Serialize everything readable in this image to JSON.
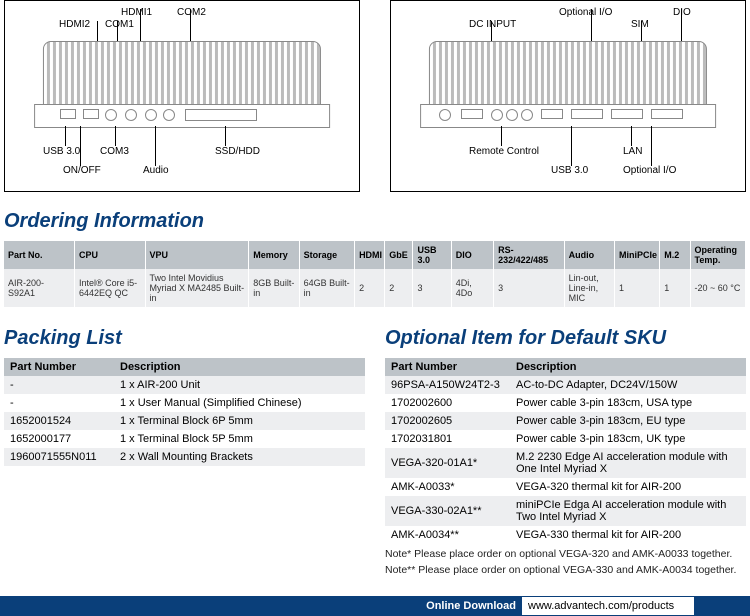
{
  "diagram_front": {
    "labels": {
      "hdmi1": "HDMI1",
      "com2": "COM2",
      "hdmi2": "HDMI2",
      "com1": "COM1",
      "usb30": "USB 3.0",
      "com3": "COM3",
      "ssd_hdd": "SSD/HDD",
      "onoff": "ON/OFF",
      "audio": "Audio"
    }
  },
  "diagram_rear": {
    "labels": {
      "optional_io_top": "Optional I/O",
      "dio": "DIO",
      "dc_input": "DC INPUT",
      "sim": "SIM",
      "remote_control": "Remote Control",
      "lan": "LAN",
      "usb30": "USB 3.0",
      "optional_io_bottom": "Optional I/O"
    }
  },
  "headings": {
    "ordering": "Ordering Information",
    "packing": "Packing List",
    "optional": "Optional Item for Default SKU"
  },
  "ordering": {
    "headers": {
      "part_no": "Part No.",
      "cpu": "CPU",
      "vpu": "VPU",
      "memory": "Memory",
      "storage": "Storage",
      "hdmi": "HDMI",
      "gbe": "GbE",
      "usb30": "USB 3.0",
      "dio": "DIO",
      "rs232": "RS-232/422/485",
      "audio": "Audio",
      "minipcie": "MiniPCIe",
      "m2": "M.2",
      "op_temp": "Operating Temp."
    },
    "row": {
      "part_no": "AIR-200-S92A1",
      "cpu": "Intel® Core i5-6442EQ QC",
      "vpu": "Two Intel Movidius Myriad X MA2485 Built-in",
      "memory": "8GB Built-in",
      "storage": "64GB Built-in",
      "hdmi": "2",
      "gbe": "2",
      "usb30": "3",
      "dio": "4Di, 4Do",
      "rs232": "3",
      "audio": "Lin-out, Line-in, MIC",
      "minipcie": "1",
      "m2": "1",
      "op_temp": "-20 ~ 60 °C"
    }
  },
  "packing": {
    "headers": {
      "pn": "Part Number",
      "desc": "Description"
    },
    "rows": [
      {
        "pn": "-",
        "desc": "1 x AIR-200 Unit"
      },
      {
        "pn": "-",
        "desc": "1 x User Manual (Simplified Chinese)"
      },
      {
        "pn": "1652001524",
        "desc": "1 x Terminal Block 6P 5mm"
      },
      {
        "pn": "1652000177",
        "desc": "1 x Terminal Block 5P 5mm"
      },
      {
        "pn": "1960071555N011",
        "desc": "2 x Wall Mounting Brackets"
      }
    ]
  },
  "optional_items": {
    "headers": {
      "pn": "Part Number",
      "desc": "Description"
    },
    "rows": [
      {
        "pn": "96PSA-A150W24T2-3",
        "desc": "AC-to-DC Adapter, DC24V/150W"
      },
      {
        "pn": "1702002600",
        "desc": "Power cable 3-pin 183cm, USA type"
      },
      {
        "pn": "1702002605",
        "desc": "Power cable 3-pin 183cm, EU type"
      },
      {
        "pn": "1702031801",
        "desc": "Power cable 3-pin 183cm, UK type"
      },
      {
        "pn": "VEGA-320-01A1*",
        "desc": "M.2 2230 Edge AI acceleration module with One Intel Myriad X"
      },
      {
        "pn": "AMK-A0033*",
        "desc": "VEGA-320 thermal kit for AIR-200"
      },
      {
        "pn": "VEGA-330-02A1**",
        "desc": "miniPCIe Edga AI acceleration module with Two Intel Myriad X"
      },
      {
        "pn": "AMK-A0034**",
        "desc": "VEGA-330 thermal kit for AIR-200"
      }
    ],
    "notes": {
      "n1": "Note* Please place order on optional VEGA-320 and AMK-A0033 together.",
      "n2": "Note** Please place order on optional VEGA-330 and AMK-A0034 together."
    }
  },
  "footer": {
    "label": "Online Download",
    "url": "www.advantech.com/products"
  }
}
